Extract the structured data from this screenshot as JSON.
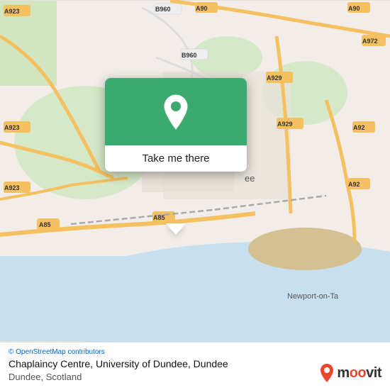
{
  "map": {
    "background_color": "#e8e0d8"
  },
  "popup": {
    "button_label": "Take me there",
    "green_color": "#3aaa6e"
  },
  "bottom_bar": {
    "attribution": "© OpenStreetMap contributors",
    "location_name": "Chaplaincy Centre, University of Dundee, Dundee",
    "location_detail": "Dundee, Scotland"
  },
  "moovit": {
    "logo_text": "moovit"
  },
  "road_labels": {
    "a923_top_left": "A923",
    "a923_mid_left": "A923",
    "a923_bottom_left": "A923",
    "a90_top": "A90",
    "a90_top_right": "A90",
    "b960_top": "B960",
    "b960_mid": "B960",
    "a929_mid_right": "A929",
    "a929_right": "A929",
    "a972_right": "A972",
    "a92_right": "A92",
    "a92_mid_right": "A92",
    "a85_left": "A85",
    "a85_mid": "A85",
    "a92_bottom": "A92",
    "newport_label": "Newport-on-Ta"
  }
}
